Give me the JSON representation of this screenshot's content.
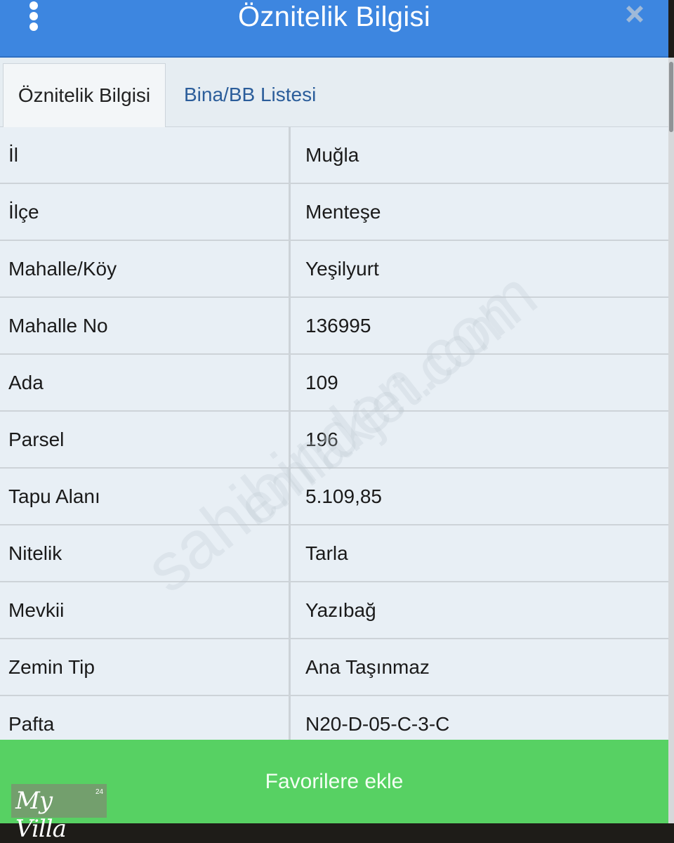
{
  "header": {
    "title": "Öznitelik Bilgisi",
    "menu_icon": "kebab-menu-icon",
    "close_icon": "close-icon",
    "color": "#3d86e0"
  },
  "tabs": [
    {
      "label": "Öznitelik Bilgisi",
      "active": true
    },
    {
      "label": "Bina/BB Listesi",
      "active": false
    }
  ],
  "attributes": [
    {
      "label": "İl",
      "value": "Muğla"
    },
    {
      "label": "İlçe",
      "value": "Menteşe"
    },
    {
      "label": "Mahalle/Köy",
      "value": "Yeşilyurt"
    },
    {
      "label": "Mahalle No",
      "value": "136995"
    },
    {
      "label": "Ada",
      "value": "109"
    },
    {
      "label": "Parsel",
      "value": "196"
    },
    {
      "label": "Tapu Alanı",
      "value": "5.109,85"
    },
    {
      "label": "Nitelik",
      "value": "Tarla"
    },
    {
      "label": "Mevkii",
      "value": "Yazıbağ"
    },
    {
      "label": "Zemin Tip",
      "value": "Ana Taşınmaz"
    },
    {
      "label": "Pafta",
      "value": "N20-D-05-C-3-C"
    }
  ],
  "favorite_button": {
    "label": "Favorilere ekle",
    "color": "#57d163"
  },
  "watermarks": [
    "sahibinden.com",
    "emlakjet.com"
  ],
  "logo": {
    "text": "My Villa",
    "sup": "24"
  }
}
